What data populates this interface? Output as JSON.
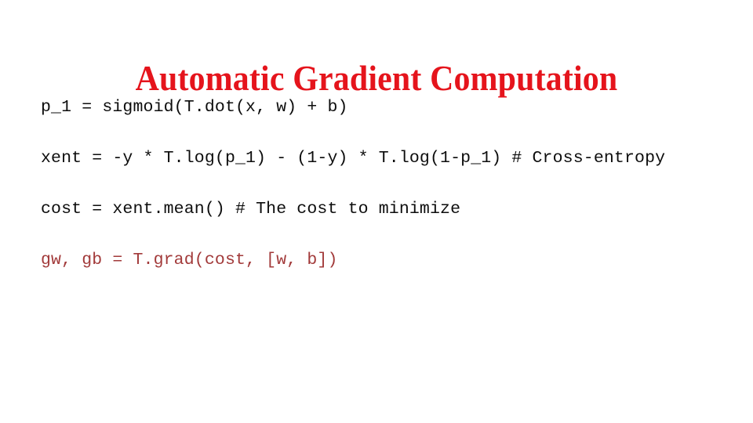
{
  "slide": {
    "title": "Automatic Gradient Computation",
    "title_color": "#e5141c",
    "background_color": "#ffffff",
    "body_text_color": "#0d0d0d",
    "highlight_text_color": "#a23a3a"
  },
  "code": {
    "lines": [
      {
        "id": "line-p1",
        "text": "p_1 = sigmoid(T.dot(x, w) + b)",
        "color": "#0d0d0d",
        "wraps": false
      },
      {
        "id": "line-xent",
        "text": "xent = -y * T.log(p_1) - (1-y) * T.log(1-p_1) # Cross-entropy",
        "color": "#0d0d0d",
        "wraps": true
      },
      {
        "id": "line-cost",
        "text": "cost = xent.mean() # The cost to minimize",
        "color": "#0d0d0d",
        "wraps": false
      },
      {
        "id": "line-grad",
        "text": "gw, gb = T.grad(cost, [w, b])",
        "color": "#a23a3a",
        "wraps": false
      }
    ]
  }
}
